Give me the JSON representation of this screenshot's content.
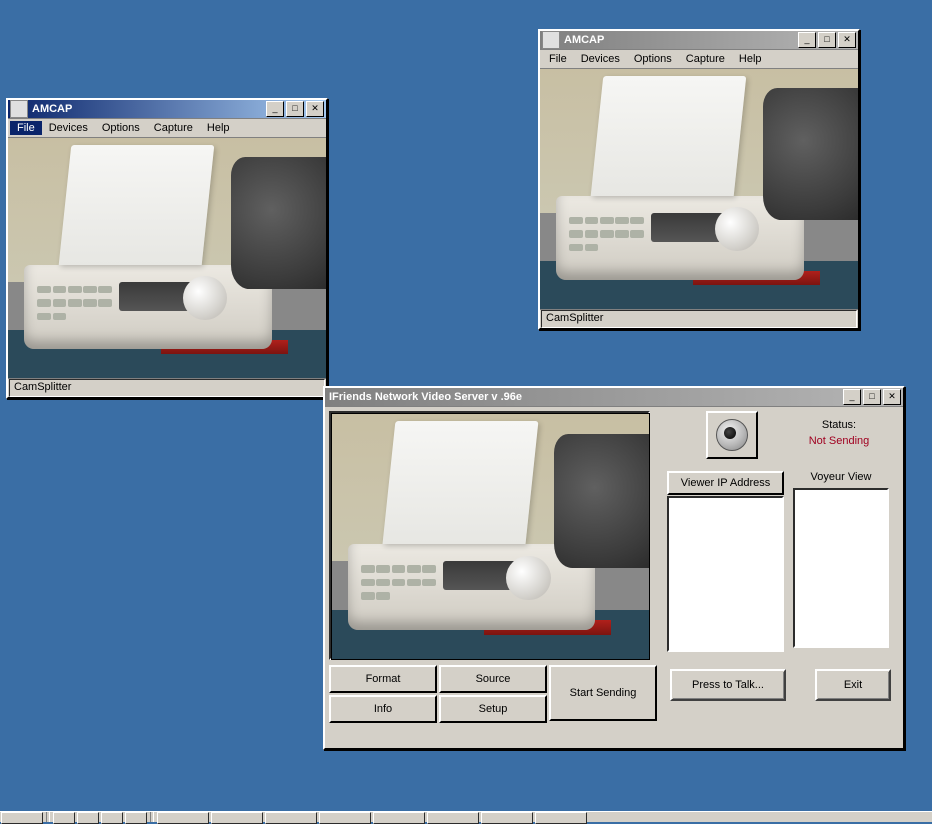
{
  "amcap1": {
    "title": "AMCAP",
    "menu": {
      "file": "File",
      "devices": "Devices",
      "options": "Options",
      "capture": "Capture",
      "help": "Help"
    },
    "status": "CamSplitter"
  },
  "amcap2": {
    "title": "AMCAP",
    "menu": {
      "file": "File",
      "devices": "Devices",
      "options": "Options",
      "capture": "Capture",
      "help": "Help"
    },
    "status": "CamSplitter"
  },
  "ifriends": {
    "title": "IFriends Network Video Server  v .96e",
    "status_label": "Status:",
    "status_value": "Not Sending",
    "viewer_ip_label": "Viewer IP Address",
    "voyeur_label": "Voyeur View",
    "buttons": {
      "format": "Format",
      "source": "Source",
      "info": "Info",
      "setup": "Setup",
      "start": "Start Sending",
      "talk": "Press to Talk...",
      "exit": "Exit"
    }
  },
  "winbtns": {
    "min": "_",
    "max": "□",
    "close": "✕"
  }
}
